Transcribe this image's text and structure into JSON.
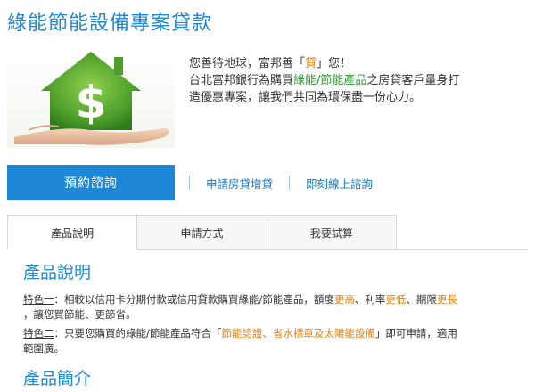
{
  "page": {
    "title": "綠能節能設備專案貸款"
  },
  "intro": {
    "line1_a": "您善待地球，富邦善「",
    "line1_hl": "貸",
    "line1_b": "」您！",
    "line2_a": "台北富邦銀行為購買",
    "line2_hl": "綠能/節能產品",
    "line2_b": "之房貸客戶量身打",
    "line3": "造優惠專案，讓我們共同為環保盡一份心力。"
  },
  "cta": {
    "label": "預約諮詢"
  },
  "links": [
    "申請房貸增貸",
    "即刻線上諮詢"
  ],
  "tabs": [
    {
      "label": "產品說明",
      "active": true
    },
    {
      "label": "申請方式",
      "active": false
    },
    {
      "label": "我要試算",
      "active": false
    }
  ],
  "product": {
    "heading": "產品說明",
    "feature1": {
      "tag": "特色一",
      "colon": "：",
      "text_a": "相較以信用卡分期付款或信用貸款購買綠能/節能產品，額度",
      "hl1": "更高",
      "sep1": "、利率",
      "hl2": "更低",
      "sep2": "、期限",
      "hl3": "更長",
      "text_b": "，讓您買節能、更節省。"
    },
    "feature2": {
      "tag": "特色二",
      "colon": "：",
      "text_a": "只要您購買的綠能/節能產品符合「",
      "hl": "節能認證、省水標章及太陽能設備",
      "text_b": "」即可申請，適用",
      "text_c": "範圍廣。"
    }
  },
  "intro_section": {
    "heading": "產品簡介"
  },
  "colors": {
    "accent_blue": "#1f8ad6",
    "button_blue": "#1d87d8",
    "highlight_orange": "#e8820c",
    "highlight_green": "#2f9b2f"
  }
}
